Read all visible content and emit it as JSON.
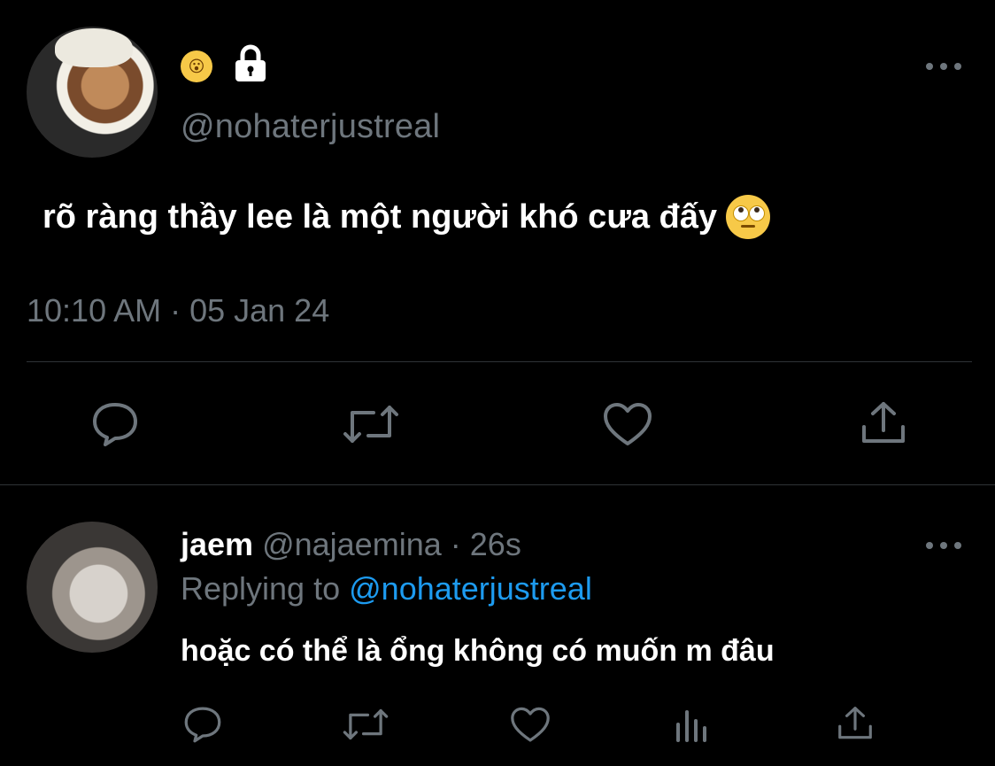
{
  "main_tweet": {
    "username": "@nohaterjustreal",
    "text": "rõ ràng thầy lee là một người khó cưa đấy",
    "timestamp": "10:10 AM · 05 Jan 24",
    "name_emoji": "yawning-face",
    "lock_icon": "lock-icon",
    "text_emoji": "face-with-rolling-eyes"
  },
  "reply_tweet": {
    "name": "jaem",
    "handle": "@najaemina",
    "separator": "·",
    "time": "26s",
    "replying_prefix": "Replying to",
    "replying_target": "@nohaterjustreal",
    "text": "hoặc có thể là ổng không có muốn m đâu"
  },
  "colors": {
    "background": "#000000",
    "text_primary": "#ffffff",
    "text_secondary": "#6e767d",
    "link": "#1d9bf0",
    "divider": "#2f3336"
  },
  "actions": {
    "main": [
      "reply-icon",
      "retweet-icon",
      "like-icon",
      "share-icon"
    ],
    "reply": [
      "reply-icon",
      "retweet-icon",
      "like-icon",
      "analytics-icon",
      "share-icon"
    ]
  }
}
